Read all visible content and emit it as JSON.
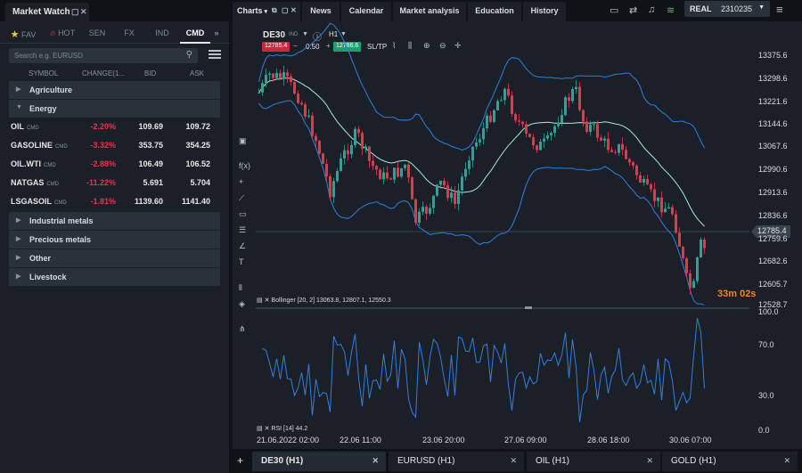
{
  "market_watch": {
    "title": "Market Watch",
    "tabs": [
      {
        "label": "FAV",
        "icon": "star-icon"
      },
      {
        "label": "HOT",
        "icon": "flame-icon"
      },
      {
        "label": "SEN"
      },
      {
        "label": "FX"
      },
      {
        "label": "IND"
      },
      {
        "label": "CMD",
        "active": true
      }
    ],
    "search_placeholder": "Search e.g. EURUSD",
    "columns": [
      "SYMBOL",
      "CHANGE(1...",
      "BID",
      "ASK"
    ],
    "groups": [
      {
        "label": "Agriculture",
        "expanded": false
      },
      {
        "label": "Energy",
        "expanded": true,
        "items": [
          {
            "symbol": "OIL",
            "tag": "CMD",
            "change": "-2.20%",
            "bid": "109.69",
            "ask": "109.72"
          },
          {
            "symbol": "GASOLINE",
            "tag": "CMD",
            "change": "-3.32%",
            "bid": "353.75",
            "ask": "354.25"
          },
          {
            "symbol": "OIL.WTI",
            "tag": "CMD",
            "change": "-2.88%",
            "bid": "106.49",
            "ask": "106.52"
          },
          {
            "symbol": "NATGAS",
            "tag": "CMD",
            "change": "-11.22%",
            "bid": "5.691",
            "ask": "5.704"
          },
          {
            "symbol": "LSGASOIL",
            "tag": "CMD",
            "change": "-1.81%",
            "bid": "1139.60",
            "ask": "1141.40"
          }
        ]
      },
      {
        "label": "Industrial metals",
        "expanded": false
      },
      {
        "label": "Precious metals",
        "expanded": false
      },
      {
        "label": "Other",
        "expanded": false
      },
      {
        "label": "Livestock",
        "expanded": false
      }
    ]
  },
  "topbar": {
    "charts_label": "Charts",
    "tabs": [
      "News",
      "Calendar",
      "Market analysis",
      "Education",
      "History"
    ],
    "account_type": "REAL",
    "account_number": "2310235"
  },
  "chart": {
    "instrument": "DE30",
    "instrument_tag": "IND",
    "timeframe": "H1",
    "sell_price": "12785.4",
    "volume": "0.50",
    "buy_price": "12786.6",
    "sltp_label": "SL/TP",
    "current_price_label": "12785.4",
    "countdown": "33m 02s",
    "bollinger_label": "Bollinger [20, 2] 13063.8, 12807.1, 12550.3",
    "rsi_label": "RSI [14] 44.2",
    "colors": {
      "up": "#26a69a",
      "down": "#e5364c",
      "band": "#2f7fe0",
      "mid": "#a8e8d8",
      "rsi": "#2f7fe0",
      "countdown": "#f0841c"
    }
  },
  "chart_data": [
    {
      "type": "candlestick",
      "y_ticks": [
        "13375.6",
        "13298.6",
        "13221.6",
        "13144.6",
        "13067.6",
        "12990.6",
        "12913.6",
        "12836.6",
        "12759.6",
        "12682.6",
        "12605.7",
        "12528.7"
      ],
      "ylim": [
        12528.7,
        13375.6
      ],
      "x_ticks": [
        "21.06.2022 02:00",
        "22.06 11:00",
        "23.06 20:00",
        "27.06 09:00",
        "28.06 18:00",
        "30.06 07:00"
      ],
      "series": [
        {
          "name": "Bollinger [20, 2]",
          "values": [
            13063.8,
            12807.1,
            12550.3
          ]
        }
      ]
    },
    {
      "type": "line",
      "y_ticks": [
        "100.0",
        "70.0",
        "30.0",
        "0.0"
      ],
      "ylim": [
        0,
        100
      ],
      "series": [
        {
          "name": "RSI [14]",
          "last": 44.2
        }
      ]
    }
  ],
  "bottom_tabs": [
    {
      "label": "DE30 (H1)",
      "active": true
    },
    {
      "label": "EURUSD (H1)"
    },
    {
      "label": "OIL (H1)"
    },
    {
      "label": "GOLD (H1)"
    }
  ]
}
